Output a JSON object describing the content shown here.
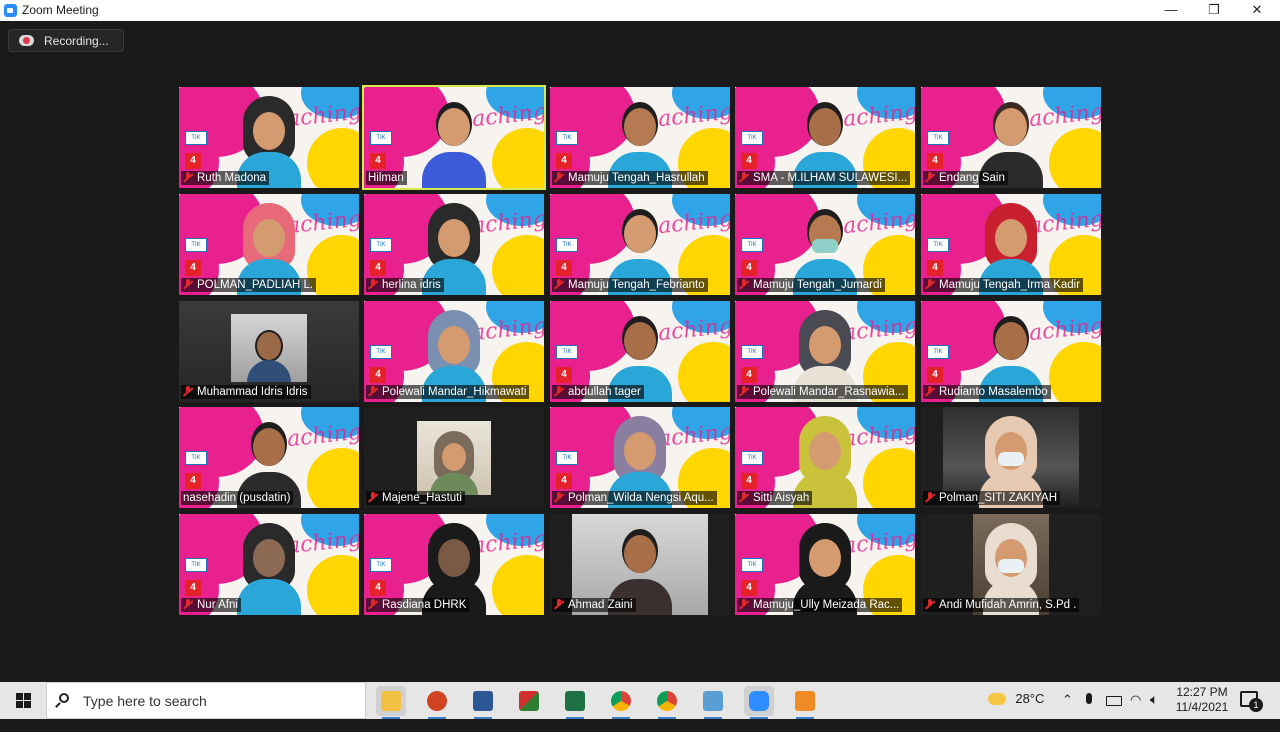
{
  "window": {
    "title": "Zoom Meeting",
    "minimize": "—",
    "restore": "❐",
    "close": "✕"
  },
  "recording": {
    "label": "Recording..."
  },
  "participants": [
    {
      "name": "Ruth Madona",
      "muted": true
    },
    {
      "name": "Hilman",
      "muted": false,
      "active_speaker": true
    },
    {
      "name": "Mamuju Tengah_Hasrullah",
      "muted": true
    },
    {
      "name": "SMA - M.ILHAM SULAWESI...",
      "muted": true
    },
    {
      "name": "Endang Sain",
      "muted": true
    },
    {
      "name": "POLMAN_PADLIAH L.",
      "muted": true
    },
    {
      "name": "herlina idris",
      "muted": true
    },
    {
      "name": "Mamuju Tengah_Febrianto",
      "muted": true
    },
    {
      "name": "Mamuju Tengah_Jumardi",
      "muted": true
    },
    {
      "name": "Mamuju Tengah_Irma Kadir",
      "muted": true
    },
    {
      "name": "Muhammad Idris Idris",
      "muted": true
    },
    {
      "name": "Polewali Mandar_Hikmawati",
      "muted": true
    },
    {
      "name": "abdullah tager",
      "muted": true
    },
    {
      "name": "Polewali Mandar_Rasnawia...",
      "muted": true
    },
    {
      "name": "Rudianto Masalembo",
      "muted": true
    },
    {
      "name": "nasehadin (pusdatin)",
      "muted": false
    },
    {
      "name": "Majene_Hastuti",
      "muted": true
    },
    {
      "name": "Polman_Wilda Nengsi Aqu...",
      "muted": true
    },
    {
      "name": "Sitti Aisyah",
      "muted": true
    },
    {
      "name": "Polman_SITI ZAKIYAH",
      "muted": true
    },
    {
      "name": "Nur Afni",
      "muted": true
    },
    {
      "name": "Rasdiana DHRK",
      "muted": true
    },
    {
      "name": "Ahmad Zaini",
      "muted": true
    },
    {
      "name": "Mamuju_Ully Meizada Rac...",
      "muted": true
    },
    {
      "name": "Andi Mufidah Amrin, S.Pd .",
      "muted": true
    }
  ],
  "taskbar": {
    "search_placeholder": "Type here to search",
    "apps": [
      "file-explorer",
      "powerpoint",
      "word",
      "app-red-green",
      "excel",
      "chrome",
      "chrome-2",
      "remote-desktop",
      "zoom",
      "app-orange"
    ],
    "weather": {
      "temp": "28°C"
    },
    "time": "12:27 PM",
    "date": "11/4/2021",
    "notifications": "1"
  },
  "colors": {
    "accent_pink": "#e8218f",
    "active_speaker_border": "#d6e84a",
    "muted_red": "#e02828"
  }
}
